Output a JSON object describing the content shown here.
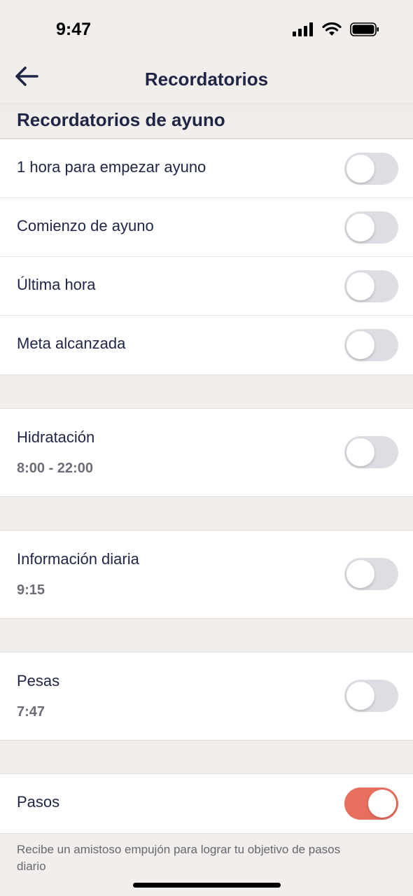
{
  "status_bar": {
    "time": "9:47",
    "icons": [
      "signal-icon",
      "wifi-icon",
      "battery-icon"
    ]
  },
  "nav": {
    "title": "Recordatorios",
    "back_icon": "arrow-left-icon"
  },
  "fasting_section": {
    "header": "Recordatorios de ayuno",
    "items": [
      {
        "label": "1 hora para empezar ayuno",
        "enabled": false
      },
      {
        "label": "Comienzo de ayuno",
        "enabled": false
      },
      {
        "label": "Última hora",
        "enabled": false
      },
      {
        "label": "Meta alcanzada",
        "enabled": false
      }
    ]
  },
  "hydration": {
    "label": "Hidratación",
    "time": "8:00 - 22:00",
    "enabled": false
  },
  "daily_info": {
    "label": "Información diaria",
    "time": "9:15",
    "enabled": false
  },
  "weights": {
    "label": "Pesas",
    "time": "7:47",
    "enabled": false
  },
  "steps": {
    "label": "Pasos",
    "enabled": true,
    "note": "Recibe un amistoso empujón para lograr tu objetivo de pasos diario"
  },
  "colors": {
    "accent": "#e86e5e",
    "toggle_off": "#dedde4",
    "text": "#1f2544",
    "background": "#f1eeec"
  }
}
